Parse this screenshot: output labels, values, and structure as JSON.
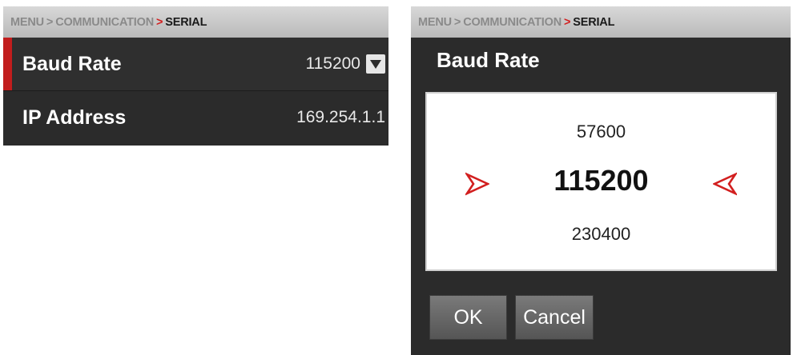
{
  "left_panel": {
    "breadcrumb": {
      "menu": "MENU",
      "sep1": ">",
      "communication": "COMMUNICATION",
      "sep2": ">",
      "current": "SERIAL"
    },
    "rows": [
      {
        "label": "Baud Rate",
        "value": "115200",
        "selected": true,
        "icon": "dropdown-arrow-icon"
      },
      {
        "label": "IP Address",
        "value": "169.254.1.1",
        "selected": false
      }
    ]
  },
  "right_panel": {
    "breadcrumb": {
      "menu": "MENU",
      "sep1": ">",
      "communication": "COMMUNICATION",
      "sep2": ">",
      "current": "SERIAL"
    },
    "dialog_title": "Baud Rate",
    "picker": {
      "above": "57600",
      "selected": "115200",
      "below": "230400",
      "left_icon": "arrow-right-icon",
      "right_icon": "arrow-left-icon"
    },
    "buttons": {
      "ok": "OK",
      "cancel": "Cancel"
    }
  },
  "colors": {
    "accent": "#c21d1d",
    "panel_bg": "#2b2b2b",
    "breadcrumb_bg": "#c8c8c8"
  }
}
